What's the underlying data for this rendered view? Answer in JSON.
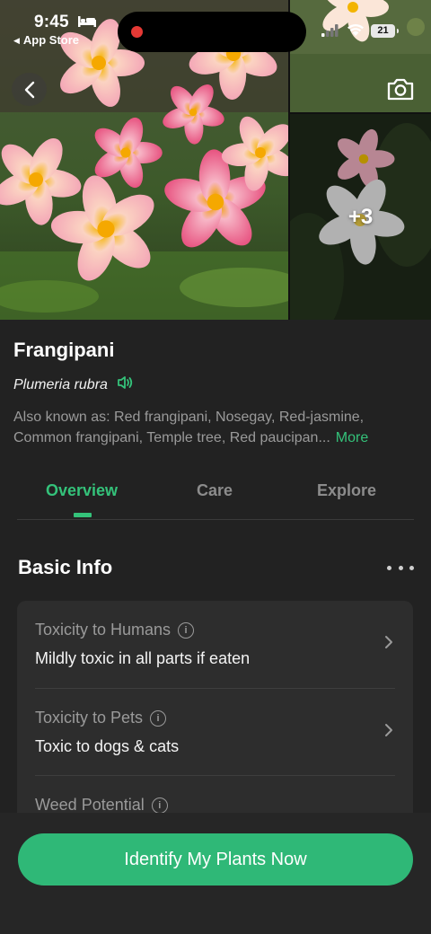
{
  "status_bar": {
    "time": "9:45",
    "back_app": "App Store",
    "battery": "21"
  },
  "gallery": {
    "more_count": "+3"
  },
  "plant": {
    "name": "Frangipani",
    "scientific_name": "Plumeria rubra",
    "aka": "Also known as: Red frangipani, Nosegay, Red-jasmine, Common frangipani, Temple tree, Red paucipan...",
    "more_label": "More"
  },
  "tabs": [
    {
      "label": "Overview",
      "active": true
    },
    {
      "label": "Care",
      "active": false
    },
    {
      "label": "Explore",
      "active": false
    }
  ],
  "basic_info": {
    "title": "Basic Info",
    "rows": [
      {
        "label": "Toxicity to Humans",
        "value": "Mildly toxic in all parts if eaten"
      },
      {
        "label": "Toxicity to Pets",
        "value": "Toxic to dogs & cats"
      },
      {
        "label": "Weed Potential",
        "value": ""
      }
    ]
  },
  "cta": {
    "label": "Identify My Plants Now"
  },
  "colors": {
    "accent": "#34c27a",
    "background": "#222222",
    "card": "#2d2d2d",
    "button": "#2fb877"
  },
  "icons": [
    "back-icon",
    "camera-icon",
    "speaker-icon",
    "info-icon",
    "chevron-right-icon",
    "more-dots-icon",
    "sleep-bed-icon",
    "wifi-icon",
    "signal-icon"
  ]
}
